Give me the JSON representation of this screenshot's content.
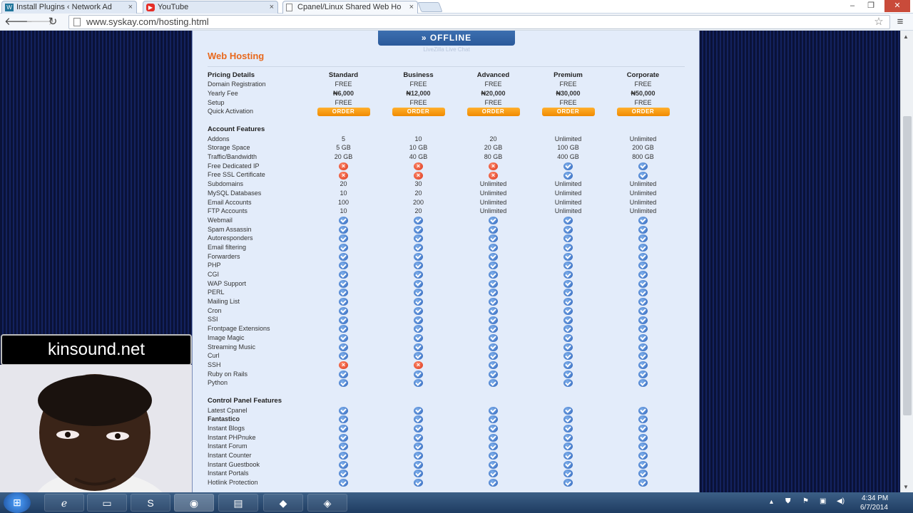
{
  "browser": {
    "tabs": [
      {
        "label": "Install Plugins ‹ Network Ad",
        "icon": "wordpress-icon"
      },
      {
        "label": "YouTube",
        "icon": "youtube-icon"
      },
      {
        "label": "Cpanel/Linux Shared Web Ho",
        "icon": "page-icon",
        "active": true
      }
    ],
    "url": "www.syskay.com/hosting.html",
    "close_glyph": "×"
  },
  "livechat": {
    "status": "» OFFLINE",
    "sub": "LiveZilla Live Chat"
  },
  "page": {
    "heading": "Web Hosting",
    "columns": [
      "Standard",
      "Business",
      "Advanced",
      "Premium",
      "Corporate"
    ],
    "pricing_title": "Pricing Details",
    "pricing_rows": [
      {
        "label": "Domain Registration",
        "values": [
          "FREE",
          "FREE",
          "FREE",
          "FREE",
          "FREE"
        ],
        "style": "free"
      },
      {
        "label": "Yearly Fee",
        "values": [
          "₦6,000",
          "₦12,000",
          "₦20,000",
          "₦30,000",
          "₦50,000"
        ],
        "style": "bold"
      },
      {
        "label": "Setup",
        "values": [
          "FREE",
          "FREE",
          "FREE",
          "FREE",
          "FREE"
        ],
        "style": "free"
      },
      {
        "label": "Quick Activation",
        "values": [
          "ORDER",
          "ORDER",
          "ORDER",
          "ORDER",
          "ORDER"
        ],
        "style": "order"
      }
    ],
    "account_title": "Account Features",
    "account_rows": [
      {
        "label": "Addons",
        "values": [
          "5",
          "10",
          "20",
          "Unlimited",
          "Unlimited"
        ]
      },
      {
        "label": "Storage Space",
        "values": [
          "5 GB",
          "10 GB",
          "20 GB",
          "100 GB",
          "200 GB"
        ]
      },
      {
        "label": "Traffic/Bandwidth",
        "values": [
          "20 GB",
          "40 GB",
          "80 GB",
          "400 GB",
          "800 GB"
        ]
      },
      {
        "label": "Free Dedicated IP",
        "values": [
          "x",
          "x",
          "x",
          "check",
          "check"
        ]
      },
      {
        "label": "Free SSL Certificate",
        "values": [
          "x",
          "x",
          "x",
          "check",
          "check"
        ]
      },
      {
        "label": "Subdomains",
        "values": [
          "20",
          "30",
          "Unlimited",
          "Unlimited",
          "Unlimited"
        ]
      },
      {
        "label": "MySQL Databases",
        "values": [
          "10",
          "20",
          "Unlimited",
          "Unlimited",
          "Unlimited"
        ]
      },
      {
        "label": "Email Accounts",
        "values": [
          "100",
          "200",
          "Unlimited",
          "Unlimited",
          "Unlimited"
        ]
      },
      {
        "label": "FTP Accounts",
        "values": [
          "10",
          "20",
          "Unlimited",
          "Unlimited",
          "Unlimited"
        ]
      },
      {
        "label": "Webmail",
        "values": [
          "check",
          "check",
          "check",
          "check",
          "check"
        ]
      },
      {
        "label": "Spam Assassin",
        "values": [
          "check",
          "check",
          "check",
          "check",
          "check"
        ]
      },
      {
        "label": "Autoresponders",
        "values": [
          "check",
          "check",
          "check",
          "check",
          "check"
        ]
      },
      {
        "label": "Email filtering",
        "values": [
          "check",
          "check",
          "check",
          "check",
          "check"
        ]
      },
      {
        "label": "Forwarders",
        "values": [
          "check",
          "check",
          "check",
          "check",
          "check"
        ]
      },
      {
        "label": "PHP",
        "values": [
          "check",
          "check",
          "check",
          "check",
          "check"
        ]
      },
      {
        "label": "CGI",
        "values": [
          "check",
          "check",
          "check",
          "check",
          "check"
        ]
      },
      {
        "label": "WAP Support",
        "values": [
          "check",
          "check",
          "check",
          "check",
          "check"
        ]
      },
      {
        "label": "PERL",
        "values": [
          "check",
          "check",
          "check",
          "check",
          "check"
        ]
      },
      {
        "label": "Mailing List",
        "values": [
          "check",
          "check",
          "check",
          "check",
          "check"
        ]
      },
      {
        "label": "Cron",
        "values": [
          "check",
          "check",
          "check",
          "check",
          "check"
        ]
      },
      {
        "label": "SSI",
        "values": [
          "check",
          "check",
          "check",
          "check",
          "check"
        ]
      },
      {
        "label": "Frontpage Extensions",
        "values": [
          "check",
          "check",
          "check",
          "check",
          "check"
        ]
      },
      {
        "label": "Image Magic",
        "values": [
          "check",
          "check",
          "check",
          "check",
          "check"
        ]
      },
      {
        "label": "Streaming Music",
        "values": [
          "check",
          "check",
          "check",
          "check",
          "check"
        ]
      },
      {
        "label": "Curl",
        "values": [
          "check",
          "check",
          "check",
          "check",
          "check"
        ]
      },
      {
        "label": "SSH",
        "values": [
          "x",
          "x",
          "check",
          "check",
          "check"
        ]
      },
      {
        "label": "Ruby on Rails",
        "values": [
          "check",
          "check",
          "check",
          "check",
          "check"
        ]
      },
      {
        "label": "Python",
        "values": [
          "check",
          "check",
          "check",
          "check",
          "check"
        ]
      }
    ],
    "cpanel_title": "Control Panel Features",
    "cpanel_rows": [
      {
        "label": "Latest Cpanel",
        "values": [
          "check",
          "check",
          "check",
          "check",
          "check"
        ]
      },
      {
        "label": "Fantastico",
        "values": [
          "check",
          "check",
          "check",
          "check",
          "check"
        ],
        "bold": true
      },
      {
        "label": "Instant Blogs",
        "values": [
          "check",
          "check",
          "check",
          "check",
          "check"
        ]
      },
      {
        "label": "Instant PHPnuke",
        "values": [
          "check",
          "check",
          "check",
          "check",
          "check"
        ]
      },
      {
        "label": "Instant Forum",
        "values": [
          "check",
          "check",
          "check",
          "check",
          "check"
        ]
      },
      {
        "label": "Instant Counter",
        "values": [
          "check",
          "check",
          "check",
          "check",
          "check"
        ]
      },
      {
        "label": "Instant Guestbook",
        "values": [
          "check",
          "check",
          "check",
          "check",
          "check"
        ]
      },
      {
        "label": "Instant Portals",
        "values": [
          "check",
          "check",
          "check",
          "check",
          "check"
        ]
      },
      {
        "label": "Hotlink Protection",
        "values": [
          "check",
          "check",
          "check",
          "check",
          "check"
        ]
      }
    ]
  },
  "overlay": {
    "watermark": "kinsound.net"
  },
  "taskbar": {
    "items": [
      "ie-icon",
      "folder-icon",
      "skype-icon",
      "chrome-icon",
      "monitor-icon",
      "app-icon",
      "app2-icon"
    ],
    "time": "4:34 PM",
    "date": "6/7/2014"
  }
}
